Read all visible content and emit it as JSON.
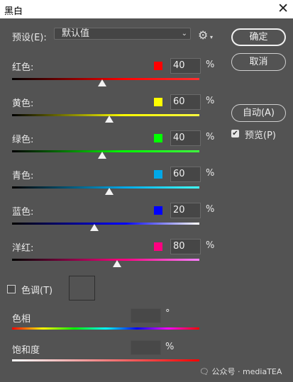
{
  "window": {
    "title": "黑白",
    "close_glyph": "✕"
  },
  "preset": {
    "label": "预设(E):",
    "value": "默认值",
    "chevron": "⌄",
    "gear_glyph": "⚙",
    "gear_caret": "▾"
  },
  "buttons": {
    "ok": "确定",
    "cancel": "取消",
    "auto": "自动(A)"
  },
  "preview": {
    "label": "预览(P)",
    "checked": true,
    "check_glyph": "✔"
  },
  "colors": [
    {
      "label": "红色:",
      "value": "40",
      "unit": "%",
      "swatch": "#ff0000",
      "track_end": "#ff3030",
      "level": 0.48
    },
    {
      "label": "黄色:",
      "value": "60",
      "unit": "%",
      "swatch": "#ffff00",
      "track_end": "#ffff40",
      "level": 0.52
    },
    {
      "label": "绿色:",
      "value": "40",
      "unit": "%",
      "swatch": "#00ff00",
      "track_end": "#40ff40",
      "level": 0.48
    },
    {
      "label": "青色:",
      "value": "60",
      "unit": "%",
      "swatch": "#00a8e8",
      "track_end": "#40ffff",
      "level": 0.52
    },
    {
      "label": "蓝色:",
      "value": "20",
      "unit": "%",
      "swatch": "#0000ff",
      "track_end": "#ffffff",
      "level": 0.44
    },
    {
      "label": "洋红:",
      "value": "80",
      "unit": "%",
      "swatch": "#ff0080",
      "track_end": "#ff80ff",
      "level": 0.56
    }
  ],
  "tint": {
    "label": "色调(T)",
    "checked": false
  },
  "hue": {
    "label": "色相",
    "unit": "°"
  },
  "saturation": {
    "label": "饱和度",
    "unit": "%"
  },
  "watermark": "🗨 公众号 · mediaTEA"
}
